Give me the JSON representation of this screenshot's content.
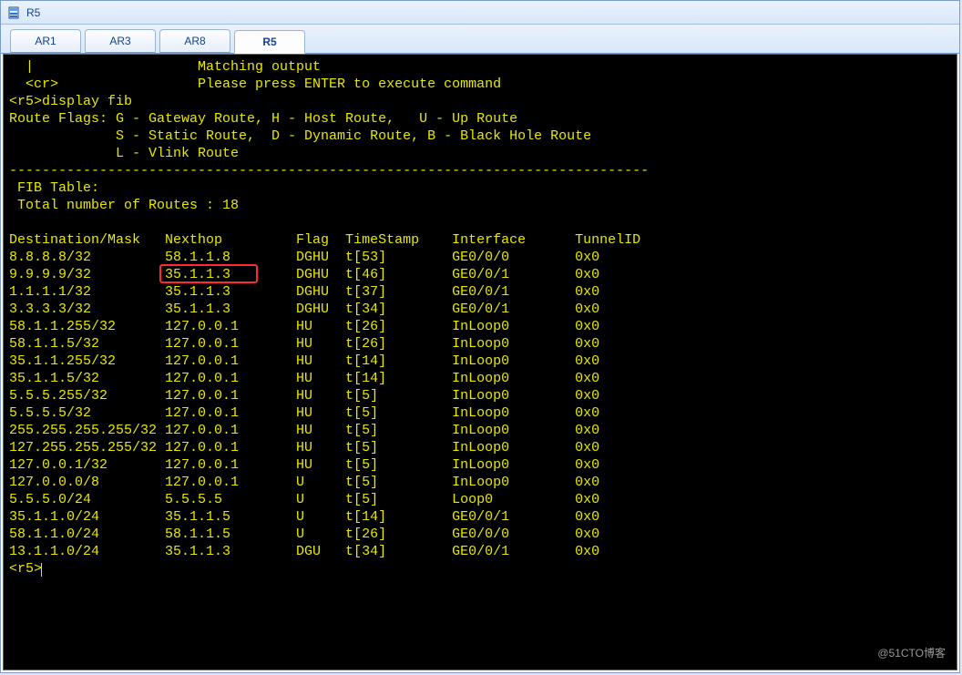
{
  "window": {
    "title": "R5"
  },
  "tabs": [
    "AR1",
    "AR3",
    "AR8",
    "R5"
  ],
  "active_tab_index": 3,
  "terminal": {
    "help_lines": [
      "  |                    Matching output",
      "  <cr>                 Please press ENTER to execute command"
    ],
    "prompt1": "<r5>display fib",
    "flags_header": "Route Flags: G - Gateway Route, H - Host Route,   U - Up Route",
    "flags_l2": "             S - Static Route,  D - Dynamic Route, B - Black Hole Route",
    "flags_l3": "             L - Vlink Route",
    "sep": "------------------------------------------------------------------------------",
    "fib_header": " FIB Table:",
    "fib_total": " Total number of Routes : 18",
    "columns": [
      "Destination/Mask",
      "Nexthop",
      "Flag",
      "TimeStamp",
      "Interface",
      "TunnelID"
    ],
    "routes": [
      {
        "dest": "8.8.8.8/32",
        "nexthop": "58.1.1.8",
        "flag": "DGHU",
        "ts": "t[53]",
        "iface": "GE0/0/0",
        "tid": "0x0"
      },
      {
        "dest": "9.9.9.9/32",
        "nexthop": "35.1.1.3",
        "flag": "DGHU",
        "ts": "t[46]",
        "iface": "GE0/0/1",
        "tid": "0x0",
        "highlight": "nexthop"
      },
      {
        "dest": "1.1.1.1/32",
        "nexthop": "35.1.1.3",
        "flag": "DGHU",
        "ts": "t[37]",
        "iface": "GE0/0/1",
        "tid": "0x0"
      },
      {
        "dest": "3.3.3.3/32",
        "nexthop": "35.1.1.3",
        "flag": "DGHU",
        "ts": "t[34]",
        "iface": "GE0/0/1",
        "tid": "0x0"
      },
      {
        "dest": "58.1.1.255/32",
        "nexthop": "127.0.0.1",
        "flag": "HU",
        "ts": "t[26]",
        "iface": "InLoop0",
        "tid": "0x0"
      },
      {
        "dest": "58.1.1.5/32",
        "nexthop": "127.0.0.1",
        "flag": "HU",
        "ts": "t[26]",
        "iface": "InLoop0",
        "tid": "0x0"
      },
      {
        "dest": "35.1.1.255/32",
        "nexthop": "127.0.0.1",
        "flag": "HU",
        "ts": "t[14]",
        "iface": "InLoop0",
        "tid": "0x0"
      },
      {
        "dest": "35.1.1.5/32",
        "nexthop": "127.0.0.1",
        "flag": "HU",
        "ts": "t[14]",
        "iface": "InLoop0",
        "tid": "0x0"
      },
      {
        "dest": "5.5.5.255/32",
        "nexthop": "127.0.0.1",
        "flag": "HU",
        "ts": "t[5]",
        "iface": "InLoop0",
        "tid": "0x0"
      },
      {
        "dest": "5.5.5.5/32",
        "nexthop": "127.0.0.1",
        "flag": "HU",
        "ts": "t[5]",
        "iface": "InLoop0",
        "tid": "0x0"
      },
      {
        "dest": "255.255.255.255/32",
        "nexthop": "127.0.0.1",
        "flag": "HU",
        "ts": "t[5]",
        "iface": "InLoop0",
        "tid": "0x0"
      },
      {
        "dest": "127.255.255.255/32",
        "nexthop": "127.0.0.1",
        "flag": "HU",
        "ts": "t[5]",
        "iface": "InLoop0",
        "tid": "0x0"
      },
      {
        "dest": "127.0.0.1/32",
        "nexthop": "127.0.0.1",
        "flag": "HU",
        "ts": "t[5]",
        "iface": "InLoop0",
        "tid": "0x0"
      },
      {
        "dest": "127.0.0.0/8",
        "nexthop": "127.0.0.1",
        "flag": "U",
        "ts": "t[5]",
        "iface": "InLoop0",
        "tid": "0x0"
      },
      {
        "dest": "5.5.5.0/24",
        "nexthop": "5.5.5.5",
        "flag": "U",
        "ts": "t[5]",
        "iface": "Loop0",
        "tid": "0x0"
      },
      {
        "dest": "35.1.1.0/24",
        "nexthop": "35.1.1.5",
        "flag": "U",
        "ts": "t[14]",
        "iface": "GE0/0/1",
        "tid": "0x0"
      },
      {
        "dest": "58.1.1.0/24",
        "nexthop": "58.1.1.5",
        "flag": "U",
        "ts": "t[26]",
        "iface": "GE0/0/0",
        "tid": "0x0"
      },
      {
        "dest": "13.1.1.0/24",
        "nexthop": "35.1.1.3",
        "flag": "DGU",
        "ts": "t[34]",
        "iface": "GE0/0/1",
        "tid": "0x0"
      }
    ],
    "prompt2": "<r5>"
  },
  "watermark": "@51CTO博客",
  "colors": {
    "term_fg": "#e8e800",
    "term_bg": "#000000",
    "highlight": "#ff2a2a"
  }
}
